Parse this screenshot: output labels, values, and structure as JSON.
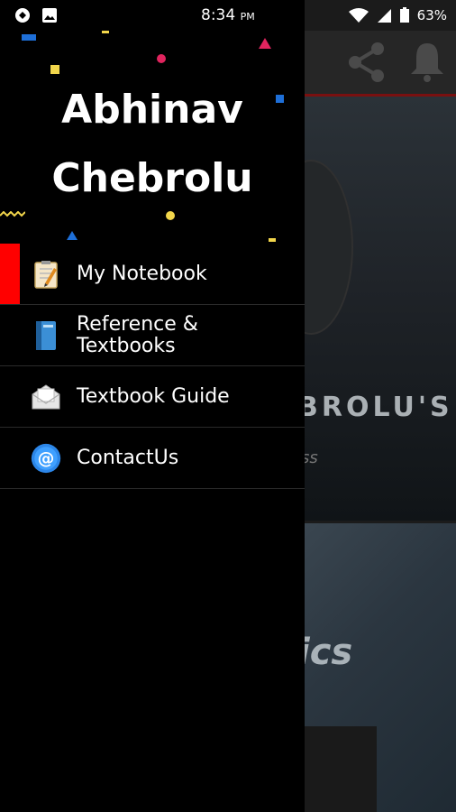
{
  "status_bar": {
    "time": "8:34",
    "ampm": "PM",
    "battery": "63%"
  },
  "drawer": {
    "user_name_line1": "Abhinav",
    "user_name_line2": "Chebrolu",
    "items": [
      {
        "label": "My Notebook",
        "icon": "notebook-icon",
        "active": true
      },
      {
        "label": "Reference &",
        "label2": "Textbooks",
        "icon": "book-icon"
      },
      {
        "label": "Textbook Guide",
        "icon": "envelope-icon"
      },
      {
        "label": "ContactUs",
        "icon": "at-icon"
      }
    ]
  },
  "background_app": {
    "hero_title": "BROLU'S",
    "hero_subtitle": "ss",
    "card_label": "ics"
  },
  "colors": {
    "accent": "#ff0000",
    "drawer_bg": "#000000"
  }
}
